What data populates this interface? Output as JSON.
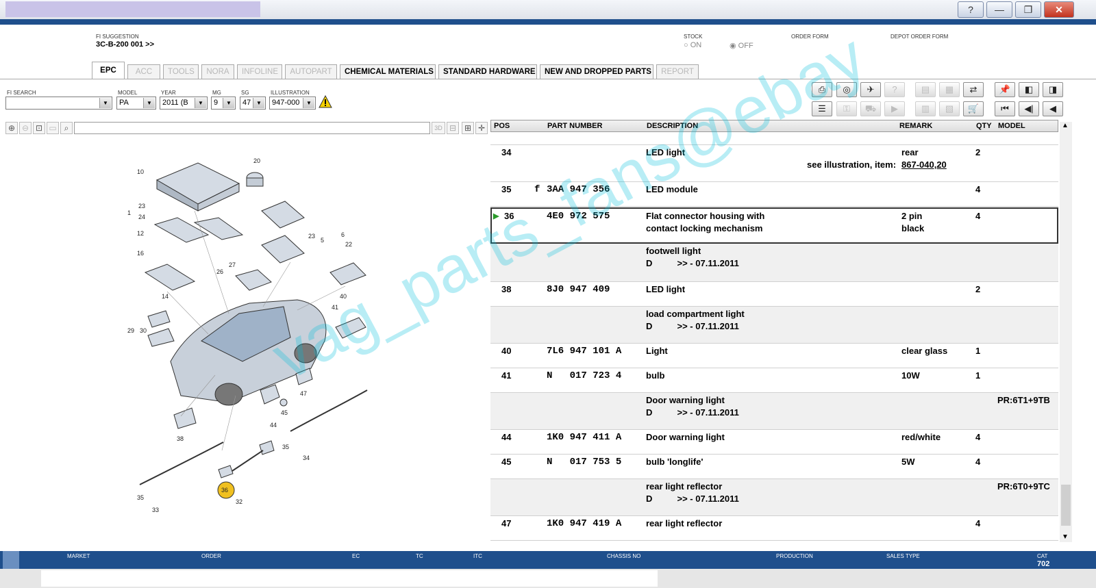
{
  "window": {
    "help": "?",
    "minimize": "—",
    "restore": "❐",
    "close": "✕"
  },
  "header": {
    "fi_label": "FI SUGGESTION",
    "fi_value": "3C-B-200 001 >>",
    "stock_label": "STOCK",
    "stock_on": "ON",
    "stock_off": "OFF",
    "order_form": "ORDER FORM",
    "depot_order_form": "DEPOT ORDER FORM"
  },
  "tabs": [
    "EPC",
    "ACC",
    "TOOLS",
    "NORA",
    "INFOLINE",
    "AUTOPART",
    "CHEMICAL MATERIALS",
    "STANDARD HARDWARE",
    "NEW AND DROPPED PARTS",
    "REPORT"
  ],
  "filters": {
    "fi_search_label": "FI SEARCH",
    "fi_search_value": "",
    "model_label": "MODEL",
    "model_value": "PA",
    "year_label": "YEAR",
    "year_value": "2011 (B",
    "mg_label": "MG",
    "mg_value": "9",
    "sg_label": "SG",
    "sg_value": "47",
    "illustration_label": "ILLUSTRATION",
    "illustration_value": "947-000"
  },
  "zoom": {
    "three_d": "3D"
  },
  "table": {
    "headers": {
      "pos": "POS",
      "part": "PART NUMBER",
      "desc": "DESCRIPTION",
      "remark": "REMARK",
      "qty": "QTY",
      "model": "MODEL"
    },
    "rows": [
      {
        "pos": "34",
        "prefix": "",
        "part": "",
        "desc": "LED light",
        "desc2": "",
        "remark": "rear",
        "remark2": "",
        "qty": "2",
        "model": "",
        "see": "see illustration, item:",
        "link": "867-040,20"
      },
      {
        "pos": "35",
        "prefix": "f",
        "part": "3AA 947 356",
        "desc": "LED module",
        "desc2": "",
        "remark": "",
        "remark2": "",
        "qty": "4",
        "model": ""
      },
      {
        "pos": "36",
        "prefix": "",
        "part": "4E0 972 575",
        "desc": "Flat connector housing with",
        "desc2": "contact locking mechanism",
        "remark": "2 pin",
        "remark2": "black",
        "qty": "4",
        "model": ""
      },
      {
        "pos": "",
        "prefix": "",
        "part": "",
        "desc": "footwell light",
        "desc2": "D          >> - 07.11.2011",
        "remark": "",
        "remark2": "",
        "qty": "",
        "model": ""
      },
      {
        "pos": "38",
        "prefix": "",
        "part": "8J0 947 409",
        "desc": "LED light",
        "desc2": "",
        "remark": "",
        "remark2": "",
        "qty": "2",
        "model": ""
      },
      {
        "pos": "",
        "prefix": "",
        "part": "",
        "desc": "load compartment light",
        "desc2": "D          >> - 07.11.2011",
        "remark": "",
        "remark2": "",
        "qty": "",
        "model": ""
      },
      {
        "pos": "40",
        "prefix": "",
        "part": "7L6 947 101 A",
        "desc": "Light",
        "desc2": "",
        "remark": "clear glass",
        "remark2": "",
        "qty": "1",
        "model": ""
      },
      {
        "pos": "41",
        "prefix": "",
        "part": "N   017 723 4",
        "desc": "bulb",
        "desc2": "",
        "remark": "10W",
        "remark2": "",
        "qty": "1",
        "model": ""
      },
      {
        "pos": "",
        "prefix": "",
        "part": "",
        "desc": "Door warning light",
        "desc2": "D          >> - 07.11.2011",
        "remark": "",
        "remark2": "",
        "qty": "",
        "model": "PR:6T1+9TB"
      },
      {
        "pos": "44",
        "prefix": "",
        "part": "1K0 947 411 A",
        "desc": "Door warning light",
        "desc2": "",
        "remark": "red/white",
        "remark2": "",
        "qty": "4",
        "model": ""
      },
      {
        "pos": "45",
        "prefix": "",
        "part": "N   017 753 5",
        "desc": "bulb 'longlife'",
        "desc2": "",
        "remark": "5W",
        "remark2": "",
        "qty": "4",
        "model": ""
      },
      {
        "pos": "",
        "prefix": "",
        "part": "",
        "desc": "rear light reflector",
        "desc2": "D          >> - 07.11.2011",
        "remark": "",
        "remark2": "",
        "qty": "",
        "model": "PR:6T0+9TC"
      },
      {
        "pos": "47",
        "prefix": "",
        "part": "1K0 947 419 A",
        "desc": "rear light reflector",
        "desc2": "",
        "remark": "",
        "remark2": "",
        "qty": "4",
        "model": ""
      }
    ]
  },
  "illustration_numbers": [
    "10",
    "20",
    "23",
    "24",
    "1",
    "12",
    "16",
    "14",
    "5",
    "23",
    "6",
    "22",
    "27",
    "26",
    "40",
    "41",
    "29",
    "30",
    "47",
    "45",
    "44",
    "38",
    "35",
    "34",
    "36",
    "32",
    "35",
    "33"
  ],
  "statusbar": {
    "market": "MARKET",
    "order": "ORDER",
    "ec": "EC",
    "tc": "TC",
    "itc": "ITC",
    "chassis": "CHASSIS NO",
    "production": "PRODUCTION",
    "sales_type": "SALES TYPE",
    "cat": "CAT",
    "cat_value": "702"
  },
  "watermark": "vag_parts_fans@ebay",
  "colors": {
    "status_blue": "#1f4f8c",
    "highlight_yellow": "#f0c020",
    "watermark": "#00bedc"
  }
}
